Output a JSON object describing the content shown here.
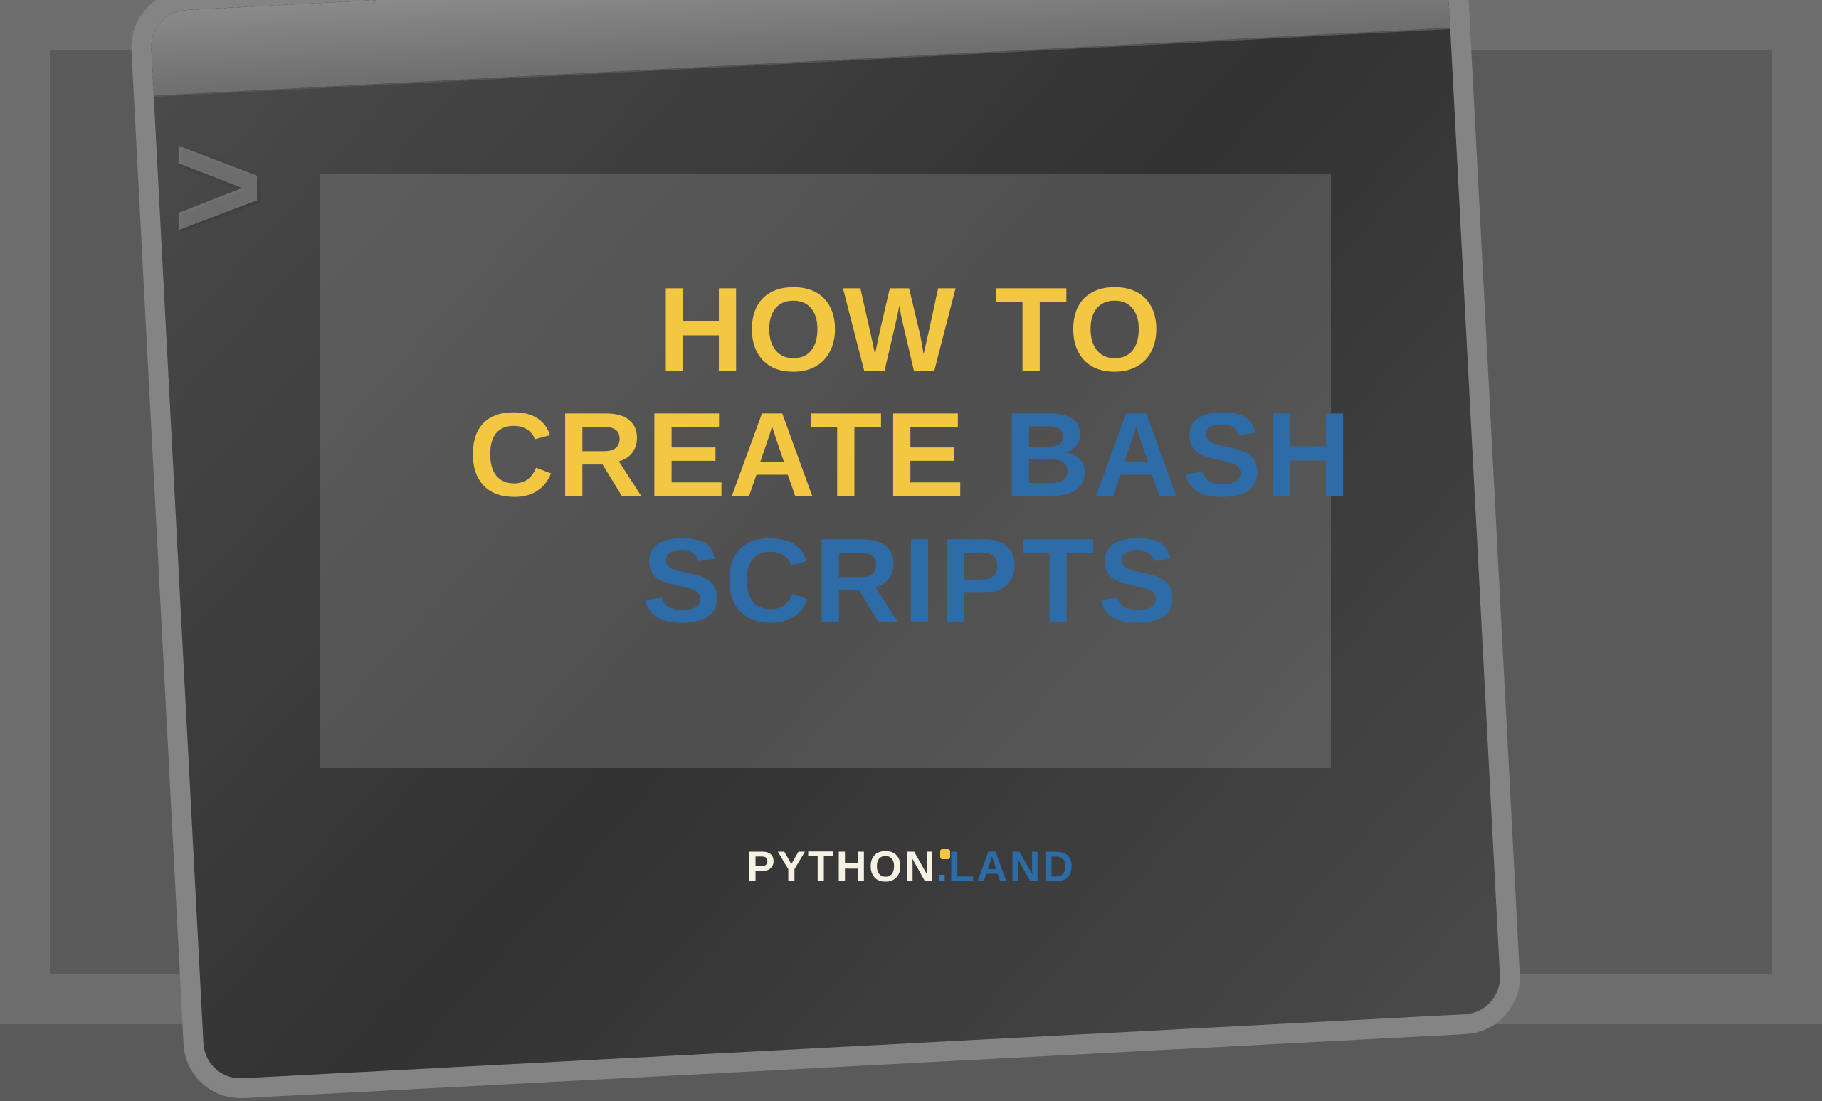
{
  "headline": {
    "line1_yellow": "HOW TO",
    "line2_yellow": "CREATE ",
    "line2_blue": "BASH",
    "line3_blue": "SCRIPTS"
  },
  "brand": {
    "part1": "PYTHON",
    "separator": ".",
    "part2": "LAND"
  },
  "prompt_symbol": ">",
  "colors": {
    "yellow": "#f4c742",
    "blue": "#2e6ca7",
    "panel_bg": "rgba(180,180,180,0.22)",
    "page_bg": "#5a5a5a"
  }
}
